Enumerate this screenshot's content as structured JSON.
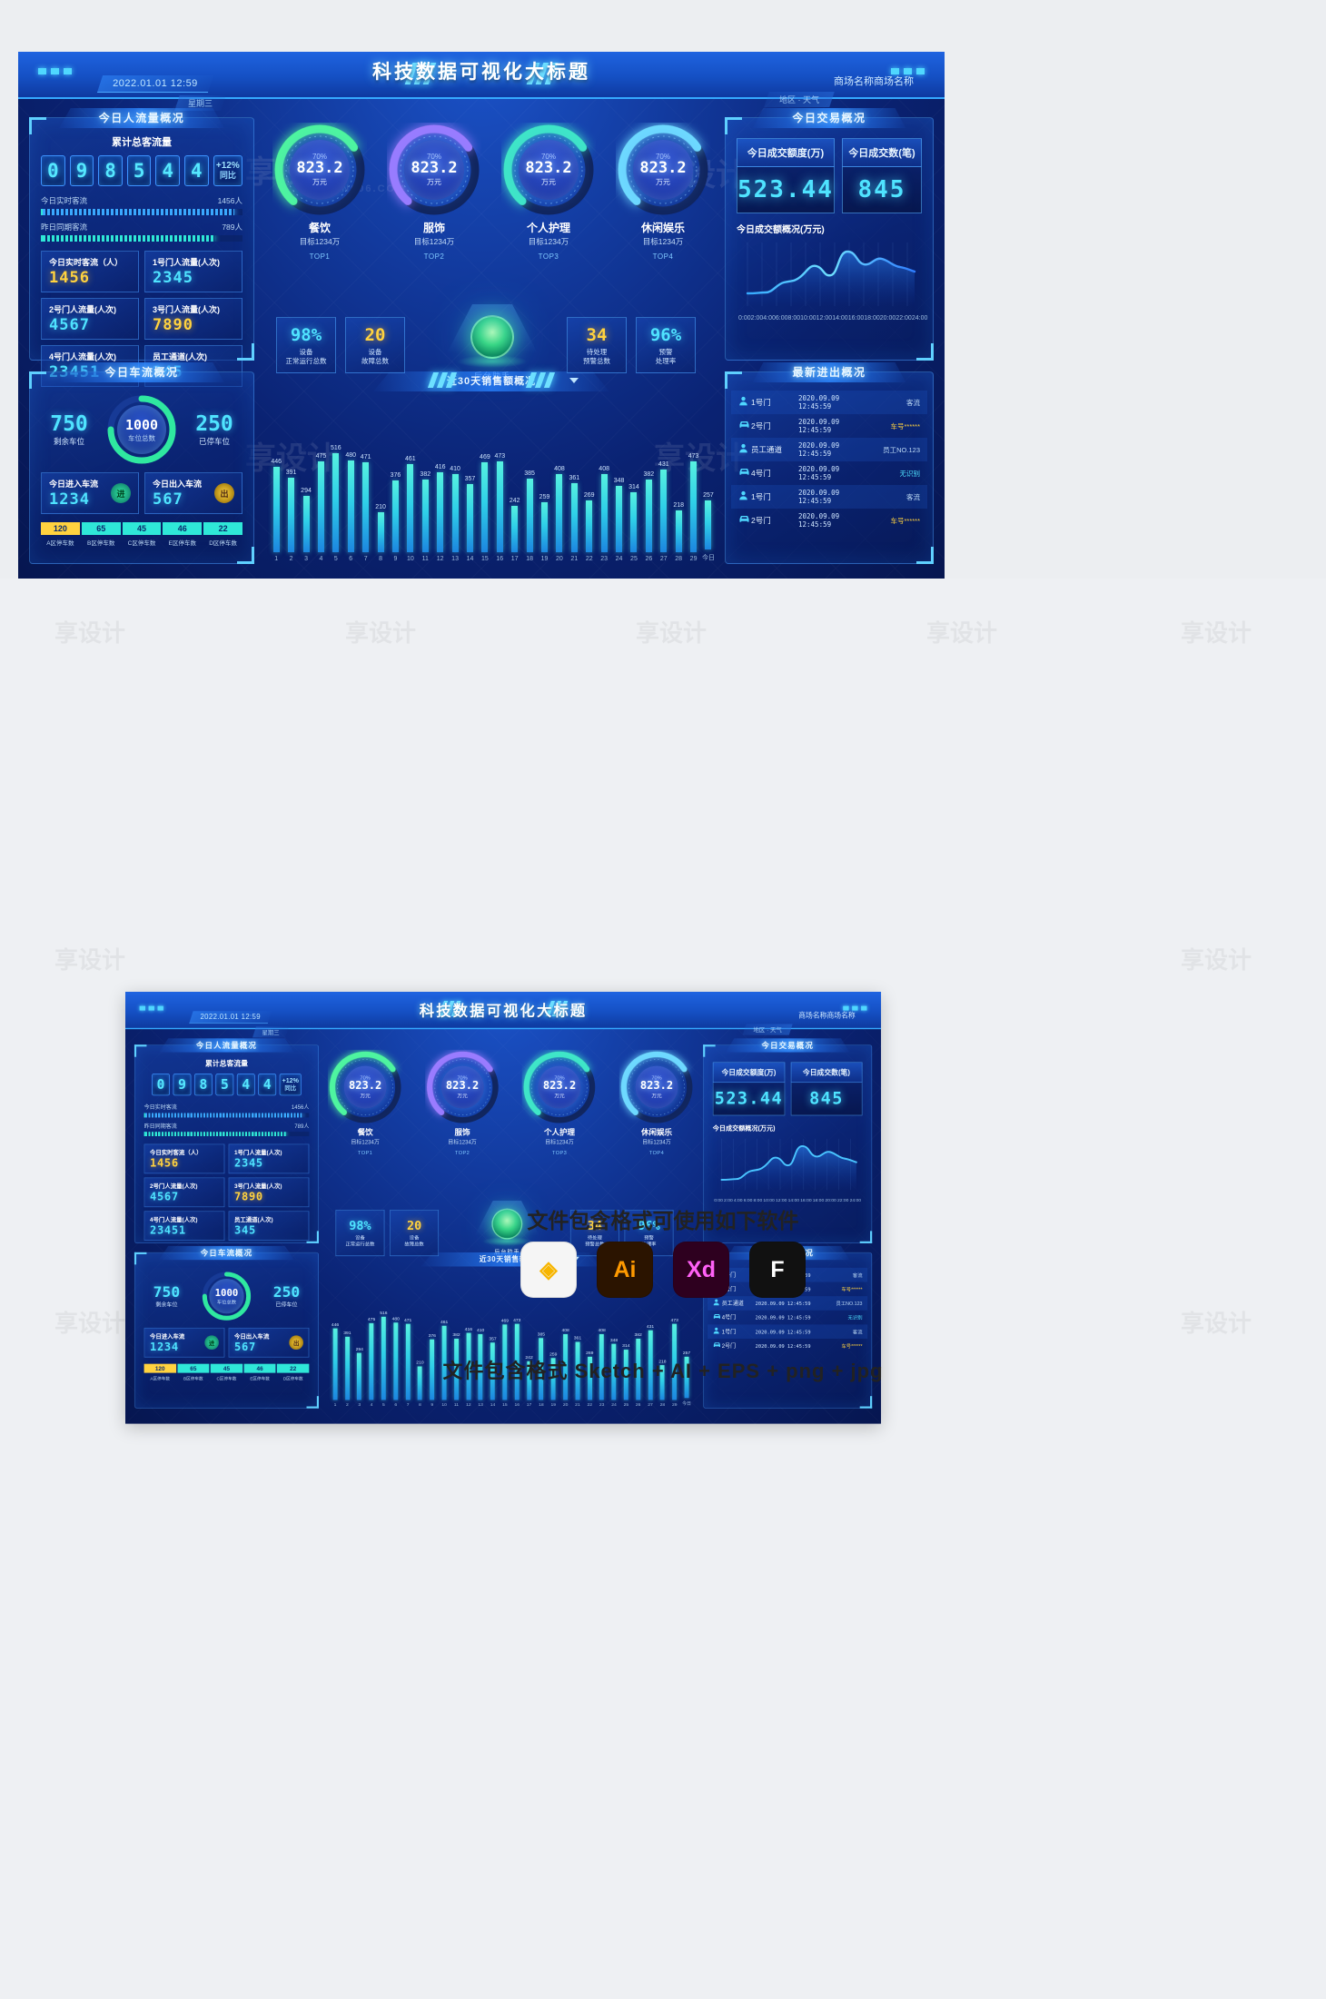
{
  "header": {
    "title": "科技数据可视化大标题",
    "datetime": "2022.01.01 12:59",
    "weekday": "星期三",
    "mall_name": "商场名称商场名称",
    "weather": "地区 · 天气"
  },
  "flow_panel": {
    "title": "今日人流量概况",
    "total_label": "累计总客流量",
    "odometer": [
      "0",
      "9",
      "8",
      "5",
      "4",
      "4"
    ],
    "compare_pct": "+12%",
    "compare_label": "同比",
    "progress": [
      {
        "label": "今日实时客流",
        "value": "1456人",
        "pct": 96,
        "color": "#3aa8ff"
      },
      {
        "label": "昨日同期客流",
        "value": "789人",
        "pct": 86,
        "color": "#2fe8d8"
      }
    ],
    "cards": [
      {
        "label": "今日实时客流（人）",
        "value": "1456",
        "color": "yellow"
      },
      {
        "label": "1号门人流量(人次)",
        "value": "2345",
        "color": "cyan"
      },
      {
        "label": "2号门人流量(人次)",
        "value": "4567",
        "color": "cyan"
      },
      {
        "label": "3号门人流量(人次)",
        "value": "7890",
        "color": "yellow"
      },
      {
        "label": "4号门人流量(人次)",
        "value": "23451",
        "color": "cyan"
      },
      {
        "label": "员工通道(人次)",
        "value": "345",
        "color": "cyan"
      }
    ]
  },
  "gauges": [
    {
      "pct": "70%",
      "value": "823.2",
      "unit": "万元",
      "name": "餐饮",
      "target": "目标1234万",
      "top": "TOP1",
      "ring": "#4ef5a0"
    },
    {
      "pct": "70%",
      "value": "823.2",
      "unit": "万元",
      "name": "服饰",
      "target": "目标1234万",
      "top": "TOP2",
      "ring": "#9a7cff"
    },
    {
      "pct": "70%",
      "value": "823.2",
      "unit": "万元",
      "name": "个人护理",
      "target": "目标1234万",
      "top": "TOP3",
      "ring": "#3fe6c8"
    },
    {
      "pct": "70%",
      "value": "823.2",
      "unit": "万元",
      "name": "休闲娱乐",
      "target": "目标1234万",
      "top": "TOP4",
      "ring": "#6ed9ff"
    }
  ],
  "kpis": [
    {
      "n": "98%",
      "t": "设备\n正常运行总数",
      "color": "cyan"
    },
    {
      "n": "20",
      "t": "设备\n故障总数",
      "color": "yellow"
    },
    {
      "n": "34",
      "t": "待处理\n预警总数",
      "color": "yellow"
    },
    {
      "n": "96%",
      "t": "预警\n处理率",
      "color": "cyan"
    }
  ],
  "orb": {
    "label": "后台助手"
  },
  "transaction": {
    "title": "今日交易概况",
    "metrics": [
      {
        "label": "今日成交额度(万)",
        "value": "523.44"
      },
      {
        "label": "今日成交数(笔)",
        "value": "845"
      }
    ],
    "chart_title": "今日成交额概况(万元)",
    "x_ticks": [
      "0:00",
      "2:00",
      "4:00",
      "6:00",
      "8:00",
      "10:00",
      "12:00",
      "14:00",
      "16:00",
      "18:00",
      "20:00",
      "22:00",
      "24:00"
    ]
  },
  "parking": {
    "title": "今日车流概况",
    "remain": {
      "value": "750",
      "label": "剩余车位"
    },
    "parked": {
      "value": "250",
      "label": "已停车位"
    },
    "donut": {
      "value": "1000",
      "label": "车位总数"
    },
    "in": {
      "label": "今日进入车流",
      "value": "1234",
      "icon": "进"
    },
    "out": {
      "label": "今日出入车流",
      "value": "567",
      "icon": "出"
    },
    "zones": [
      {
        "v": "120",
        "l": "A区停车数",
        "c": "#ffd23f"
      },
      {
        "v": "65",
        "l": "B区停车数",
        "c": "#2fe8d8"
      },
      {
        "v": "45",
        "l": "C区停车数",
        "c": "#2fe8d8"
      },
      {
        "v": "46",
        "l": "E区停车数",
        "c": "#2fe8d8"
      },
      {
        "v": "22",
        "l": "D区停车数",
        "c": "#2fe8d8"
      }
    ]
  },
  "sales": {
    "title": "近30天销售额概况",
    "labels": [
      "1",
      "2",
      "3",
      "4",
      "5",
      "6",
      "7",
      "8",
      "9",
      "10",
      "11",
      "12",
      "13",
      "14",
      "15",
      "16",
      "17",
      "18",
      "19",
      "20",
      "21",
      "22",
      "23",
      "24",
      "25",
      "26",
      "27",
      "28",
      "29",
      "今日"
    ],
    "values": [
      446,
      391,
      294,
      475,
      516,
      480,
      471,
      210,
      376,
      461,
      382,
      416,
      410,
      357,
      469,
      473,
      242,
      385,
      259,
      408,
      361,
      269,
      408,
      348,
      314,
      382,
      431,
      218,
      473,
      257
    ]
  },
  "entries": {
    "title": "最新进出概况",
    "rows": [
      {
        "icon": "person",
        "gate": "1号门",
        "time": "2020.09.09  12:45:59",
        "status": "客流",
        "color": "#bcd9f5"
      },
      {
        "icon": "car",
        "gate": "2号门",
        "time": "2020.09.09  12:45:59",
        "status": "车号******",
        "color": "#ffd23f"
      },
      {
        "icon": "person",
        "gate": "员工通道",
        "time": "2020.09.09  12:45:59",
        "status": "员工NO.123",
        "color": "#bcd9f5"
      },
      {
        "icon": "car",
        "gate": "4号门",
        "time": "2020.09.09  12:45:59",
        "status": "无识别",
        "color": "#4fe3ff"
      },
      {
        "icon": "person",
        "gate": "1号门",
        "time": "2020.09.09  12:45:59",
        "status": "客流",
        "color": "#bcd9f5"
      },
      {
        "icon": "car",
        "gate": "2号门",
        "time": "2020.09.09  12:45:59",
        "status": "车号******",
        "color": "#ffd23f"
      }
    ]
  },
  "chart_data": [
    {
      "type": "bar",
      "title": "近30天销售额概况",
      "categories": [
        "1",
        "2",
        "3",
        "4",
        "5",
        "6",
        "7",
        "8",
        "9",
        "10",
        "11",
        "12",
        "13",
        "14",
        "15",
        "16",
        "17",
        "18",
        "19",
        "20",
        "21",
        "22",
        "23",
        "24",
        "25",
        "26",
        "27",
        "28",
        "29",
        "今日"
      ],
      "values": [
        446,
        391,
        294,
        475,
        516,
        480,
        471,
        210,
        376,
        461,
        382,
        416,
        410,
        357,
        469,
        473,
        242,
        385,
        259,
        408,
        361,
        269,
        408,
        348,
        314,
        382,
        431,
        218,
        473,
        257
      ],
      "xlabel": "",
      "ylabel": "",
      "ylim": [
        0,
        560
      ],
      "grid": false,
      "legend": "none"
    },
    {
      "type": "area",
      "title": "今日成交额概况(万元)",
      "x": [
        "0:00",
        "2:00",
        "4:00",
        "6:00",
        "8:00",
        "10:00",
        "12:00",
        "14:00",
        "16:00",
        "18:00",
        "20:00",
        "22:00",
        "24:00"
      ],
      "values": [
        18,
        18,
        19,
        30,
        34,
        48,
        46,
        62,
        78,
        62,
        70,
        60,
        52
      ],
      "xlabel": "",
      "ylabel": "",
      "grid": true,
      "legend": "none"
    },
    {
      "type": "pie",
      "title": "品类目标达成",
      "categories": [
        "餐饮",
        "服饰",
        "个人护理",
        "休闲娱乐"
      ],
      "values": [
        70,
        70,
        70,
        70
      ],
      "legend": "none"
    }
  ],
  "footer": {
    "headline": "文件包含格式可使用如下软件",
    "formats": "文件包含格式 Sketch + AI + EPS + png + jpg",
    "apps": [
      {
        "name": "Sketch",
        "glyph": "◈",
        "bg": "#f5f5f5",
        "fg": "#f7b500"
      },
      {
        "name": "Illustrator",
        "glyph": "Ai",
        "bg": "#2b1400",
        "fg": "#ff9a00"
      },
      {
        "name": "Adobe XD",
        "glyph": "Xd",
        "bg": "#2e001f",
        "fg": "#ff61f6"
      },
      {
        "name": "Figma",
        "glyph": "F",
        "bg": "#111111",
        "fg": "#ffffff"
      }
    ]
  },
  "watermarks": {
    "brand": "享设计",
    "site": "DESIGN006.COM"
  }
}
